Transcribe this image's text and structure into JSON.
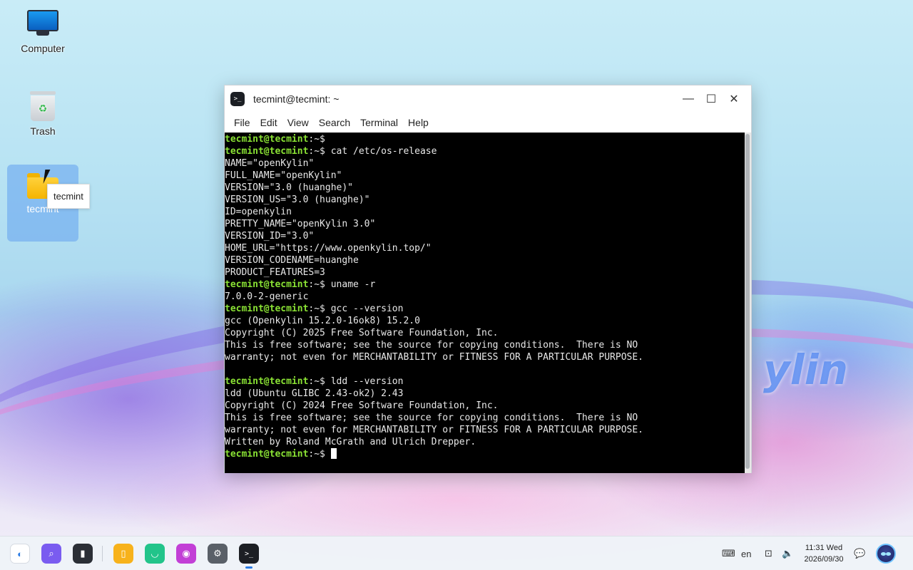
{
  "desktop": {
    "icons": [
      {
        "label": "Computer"
      },
      {
        "label": "Trash"
      },
      {
        "label": "tecmint"
      }
    ],
    "tooltip": "tecmint",
    "brand_text": "ylin"
  },
  "window": {
    "title": "tecmint@tecmint: ~",
    "app_icon_glyph": ">_",
    "controls": {
      "minimize": "—",
      "maximize": "☐",
      "close": "✕"
    },
    "menu": [
      "File",
      "Edit",
      "View",
      "Search",
      "Terminal",
      "Help"
    ]
  },
  "terminal": {
    "prompt_user": "tecmint@tecmint",
    "prompt_path": ":~$",
    "lines": [
      {
        "type": "prompt",
        "cmd": ""
      },
      {
        "type": "prompt",
        "cmd": " cat /etc/os-release"
      },
      {
        "type": "out",
        "text": "NAME=\"openKylin\""
      },
      {
        "type": "out",
        "text": "FULL_NAME=\"openKylin\""
      },
      {
        "type": "out",
        "text": "VERSION=\"3.0 (huanghe)\""
      },
      {
        "type": "out",
        "text": "VERSION_US=\"3.0 (huanghe)\""
      },
      {
        "type": "out",
        "text": "ID=openkylin"
      },
      {
        "type": "out",
        "text": "PRETTY_NAME=\"openKylin 3.0\""
      },
      {
        "type": "out",
        "text": "VERSION_ID=\"3.0\""
      },
      {
        "type": "out",
        "text": "HOME_URL=\"https://www.openkylin.top/\""
      },
      {
        "type": "out",
        "text": "VERSION_CODENAME=huanghe"
      },
      {
        "type": "out",
        "text": "PRODUCT_FEATURES=3"
      },
      {
        "type": "prompt",
        "cmd": " uname -r"
      },
      {
        "type": "out",
        "text": "7.0.0-2-generic"
      },
      {
        "type": "prompt",
        "cmd": " gcc --version"
      },
      {
        "type": "out",
        "text": "gcc (Openkylin 15.2.0-16ok8) 15.2.0"
      },
      {
        "type": "out",
        "text": "Copyright (C) 2025 Free Software Foundation, Inc."
      },
      {
        "type": "out",
        "text": "This is free software; see the source for copying conditions.  There is NO"
      },
      {
        "type": "out",
        "text": "warranty; not even for MERCHANTABILITY or FITNESS FOR A PARTICULAR PURPOSE."
      },
      {
        "type": "out",
        "text": ""
      },
      {
        "type": "prompt",
        "cmd": " ldd --version"
      },
      {
        "type": "out",
        "text": "ldd (Ubuntu GLIBC 2.43-ok2) 2.43"
      },
      {
        "type": "out",
        "text": "Copyright (C) 2024 Free Software Foundation, Inc."
      },
      {
        "type": "out",
        "text": "This is free software; see the source for copying conditions.  There is NO"
      },
      {
        "type": "out",
        "text": "warranty; not even for MERCHANTABILITY or FITNESS FOR A PARTICULAR PURPOSE."
      },
      {
        "type": "out",
        "text": "Written by Roland McGrath and Ulrich Drepper."
      },
      {
        "type": "prompt",
        "cmd": " ",
        "cursor": true
      }
    ]
  },
  "taskbar": {
    "apps": [
      {
        "name": "start-menu-icon",
        "color": "#ffffff",
        "glyph": "◐"
      },
      {
        "name": "search-icon",
        "color": "#7a5cf0",
        "glyph": "⌕"
      },
      {
        "name": "multitask-view-icon",
        "color": "#2b2f36",
        "glyph": "▮"
      },
      {
        "name": "file-manager-icon",
        "color": "#f7b21b",
        "glyph": "▯"
      },
      {
        "name": "software-store-icon",
        "color": "#22c48a",
        "glyph": "◡"
      },
      {
        "name": "camera-icon",
        "color": "#c23fd6",
        "glyph": "◉"
      },
      {
        "name": "settings-icon",
        "color": "#5a6068",
        "glyph": "⚙"
      },
      {
        "name": "terminal-app-icon",
        "color": "#1c1f24",
        "glyph": ">_"
      }
    ],
    "tray": {
      "keyboard_glyph": "⌨",
      "language": "en",
      "network_glyph": "⊡",
      "volume_glyph": "🔈",
      "notification_glyph": "💬"
    },
    "clock": {
      "time": "11:31 Wed",
      "date": "2026/09/30"
    }
  }
}
